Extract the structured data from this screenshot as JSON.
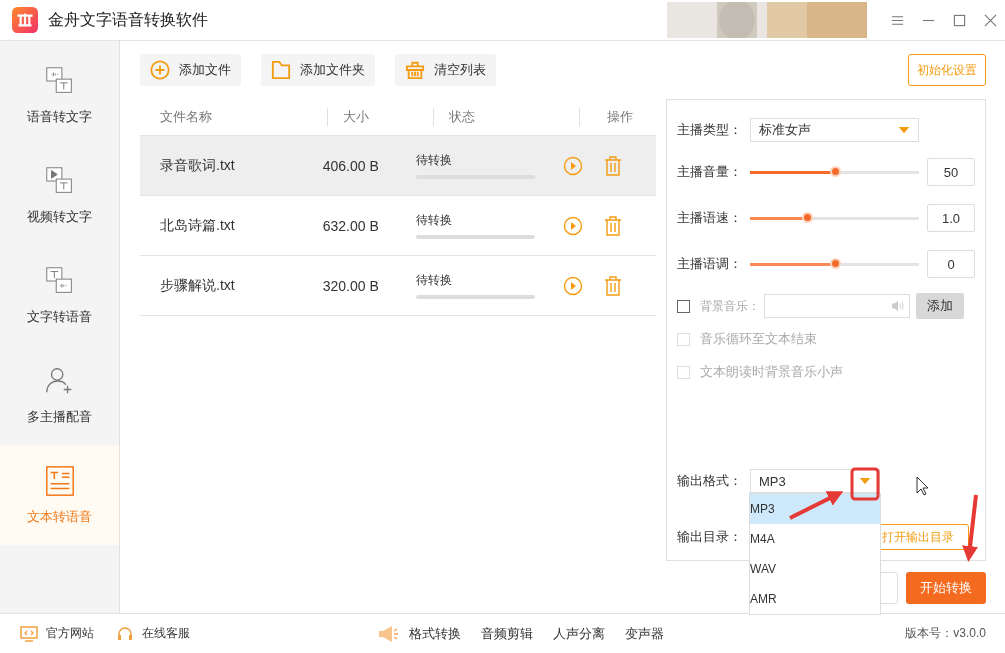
{
  "window": {
    "title": "金舟文字语音转换软件"
  },
  "sidebar": {
    "items": [
      {
        "label": "语音转文字",
        "kind": "speech2text",
        "selected": false
      },
      {
        "label": "视频转文字",
        "kind": "video2text",
        "selected": false
      },
      {
        "label": "文字转语音",
        "kind": "text2speech",
        "selected": false
      },
      {
        "label": "多主播配音",
        "kind": "multi",
        "selected": false
      },
      {
        "label": "文本转语音",
        "kind": "doc2speech",
        "selected": true
      }
    ]
  },
  "toolbar": {
    "buttons": [
      {
        "label": "添加文件",
        "kind": "add"
      },
      {
        "label": "添加文件夹",
        "kind": "folder"
      },
      {
        "label": "清空列表",
        "kind": "clear"
      }
    ],
    "reset_button": "初始化设置"
  },
  "table": {
    "columns": [
      "文件名称",
      "大小",
      "状态",
      "操作"
    ],
    "rows": [
      {
        "name": "录音歌词.txt",
        "size": "406.00 B",
        "status": "待转换",
        "selected": true
      },
      {
        "name": "北岛诗篇.txt",
        "size": "632.00 B",
        "status": "待转换",
        "selected": false
      },
      {
        "name": "步骤解说.txt",
        "size": "320.00 B",
        "status": "待转换",
        "selected": false
      }
    ]
  },
  "settings": {
    "voice_type": {
      "label": "主播类型：",
      "value": "标准女声"
    },
    "sliders": [
      {
        "label": "主播音量：",
        "level": 0.5,
        "value": "50"
      },
      {
        "label": "主播语速：",
        "level": 0.34,
        "value": "1.0"
      },
      {
        "label": "主播语调：",
        "level": 0.5,
        "value": "0"
      }
    ],
    "background_music": {
      "label": "背景音乐：",
      "checked": false,
      "button": "添加"
    },
    "options": [
      {
        "label": "音乐循环至文本结束",
        "checked": false,
        "disabled": true
      },
      {
        "label": "文本朗读时背景音乐小声",
        "checked": false,
        "disabled": true
      }
    ],
    "output_format": {
      "label": "输出格式：",
      "value": "MP3",
      "expanded": true,
      "options": [
        {
          "label": "MP3",
          "selected": true
        },
        {
          "label": "M4A",
          "selected": false
        },
        {
          "label": "WAV",
          "selected": false
        },
        {
          "label": "AMR",
          "selected": false
        }
      ]
    },
    "output_dir": {
      "label": "输出目录：",
      "button": "打开输出目录"
    }
  },
  "start_button": "开始转换",
  "footer": {
    "links": [
      {
        "label": "官方网站",
        "kind": "web"
      },
      {
        "label": "在线客服",
        "kind": "support"
      }
    ],
    "tools": [
      "格式转换",
      "音频剪辑",
      "人声分离",
      "变声器"
    ],
    "version": "版本号：v3.0.0"
  }
}
